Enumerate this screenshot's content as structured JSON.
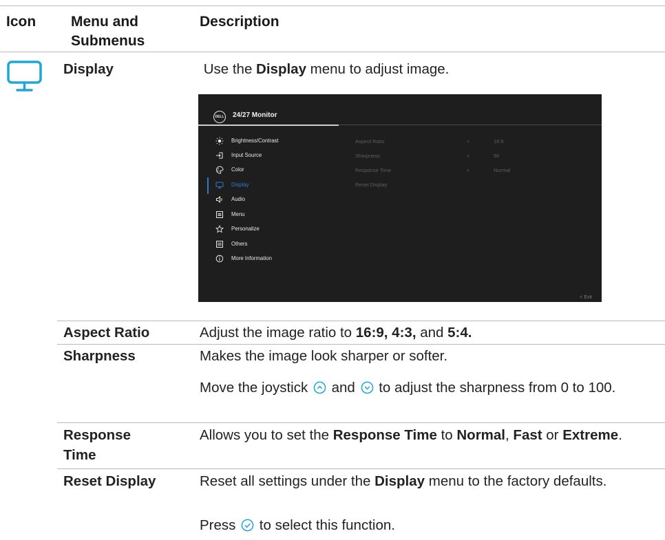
{
  "header": {
    "col_icon": "Icon",
    "col_menu": "Menu and Submenus",
    "col_desc": "Description"
  },
  "display_row": {
    "icon": "monitor-icon",
    "label": "Display",
    "desc_pre": " Use the ",
    "desc_bold": "Display",
    "desc_post": " menu to adjust image."
  },
  "osd": {
    "brand": "DELL",
    "model": "24/27 Monitor",
    "menu": [
      {
        "icon": "sun-icon",
        "label": "Brightness/Contrast"
      },
      {
        "icon": "input-icon",
        "label": "Input Source"
      },
      {
        "icon": "palette-icon",
        "label": "Color"
      },
      {
        "icon": "display-icon",
        "label": "Display"
      },
      {
        "icon": "speaker-icon",
        "label": "Audio"
      },
      {
        "icon": "menu-icon",
        "label": "Menu"
      },
      {
        "icon": "star-icon",
        "label": "Personalize"
      },
      {
        "icon": "others-icon",
        "label": "Others"
      },
      {
        "icon": "info-icon",
        "label": "More Information"
      }
    ],
    "selected": "Display",
    "submenu": [
      {
        "label": "Aspect Ratio",
        "arrow": ">",
        "value": "16:9"
      },
      {
        "label": "Sharpness",
        "arrow": ">",
        "value": "50"
      },
      {
        "label": "Response Time",
        "arrow": ">",
        "value": "Normal"
      },
      {
        "label": "Reset Display",
        "arrow": "",
        "value": ""
      }
    ],
    "exit": "<  Exit"
  },
  "rows": {
    "aspect": {
      "label": "Aspect Ratio",
      "pre": "Adjust the image ratio to ",
      "bold1": "16:9, 4:3,",
      "mid": " and ",
      "bold2": "5:4."
    },
    "sharpness": {
      "label": "Sharpness",
      "line1": "Makes the image look sharper or softer.",
      "line2_pre": "Move the joystick ",
      "line2_mid": " and ",
      "line2_post": " to adjust the sharpness from 0 to 100."
    },
    "response": {
      "label": "Response Time",
      "pre": "Allows you to set the ",
      "b1": "Response Time",
      "t1": " to ",
      "b2": "Normal",
      "t2": ", ",
      "b3": "Fast",
      "t3": " or ",
      "b4": "Extreme",
      "t4": "."
    },
    "reset": {
      "label": "Reset Display",
      "pre": "Reset all settings under the ",
      "bold": "Display",
      "post": " menu to the factory defaults.",
      "press_pre": "Press ",
      "press_post": " to select this function."
    }
  },
  "colors": {
    "accent": "#1ea7d6",
    "osd_bg": "#1e1e1e",
    "osd_selected": "#2e7ad2"
  }
}
